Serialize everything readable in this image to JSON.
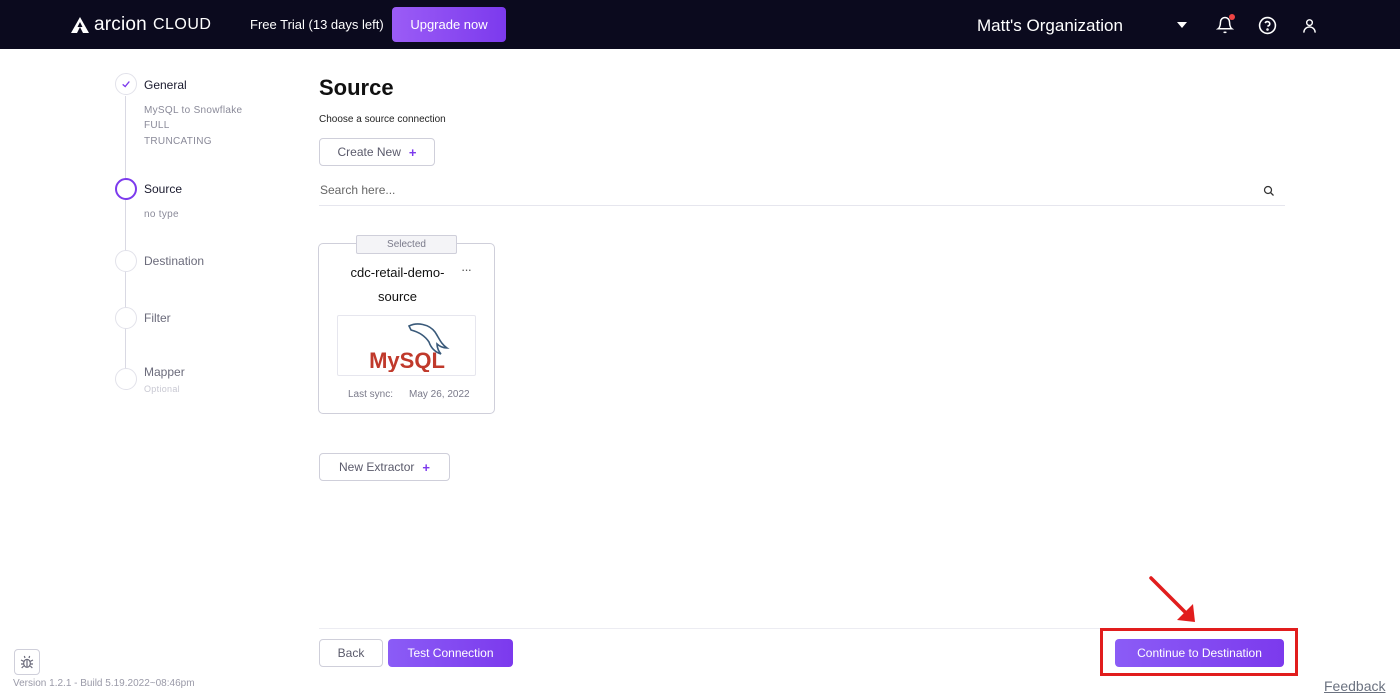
{
  "header": {
    "brand": "arcion",
    "brand_suffix": "CLOUD",
    "trial_text": "Free Trial (13 days left)",
    "upgrade_label": "Upgrade now",
    "organization": "Matt's Organization"
  },
  "stepper": {
    "steps": [
      {
        "label": "General",
        "status": "done",
        "sub": [
          "MySQL to Snowflake",
          "FULL",
          "TRUNCATING"
        ]
      },
      {
        "label": "Source",
        "status": "active",
        "sub": [
          "no type"
        ]
      },
      {
        "label": "Destination",
        "status": "pending"
      },
      {
        "label": "Filter",
        "status": "pending"
      },
      {
        "label": "Mapper",
        "status": "pending",
        "sub": [
          "Optional"
        ]
      }
    ]
  },
  "main": {
    "title": "Source",
    "subtitle": "Choose a source connection",
    "create_new_label": "Create New",
    "search_placeholder": "Search here...",
    "card": {
      "tag": "Selected",
      "name": "cdc-retail-demo-source",
      "menu": "···",
      "logo_text": "MySQL",
      "sync_label": "Last sync:",
      "sync_date": "May 26, 2022"
    },
    "new_extractor_label": "New Extractor"
  },
  "footer": {
    "back_label": "Back",
    "test_label": "Test Connection",
    "continue_label": "Continue to Destination",
    "version": "Version 1.2.1 - Build 5.19.2022~08:46pm",
    "feedback": "Feedback"
  },
  "colors": {
    "accent": "#7c3aed",
    "topbar": "#0b0a1e",
    "highlight": "#e11d1d"
  }
}
